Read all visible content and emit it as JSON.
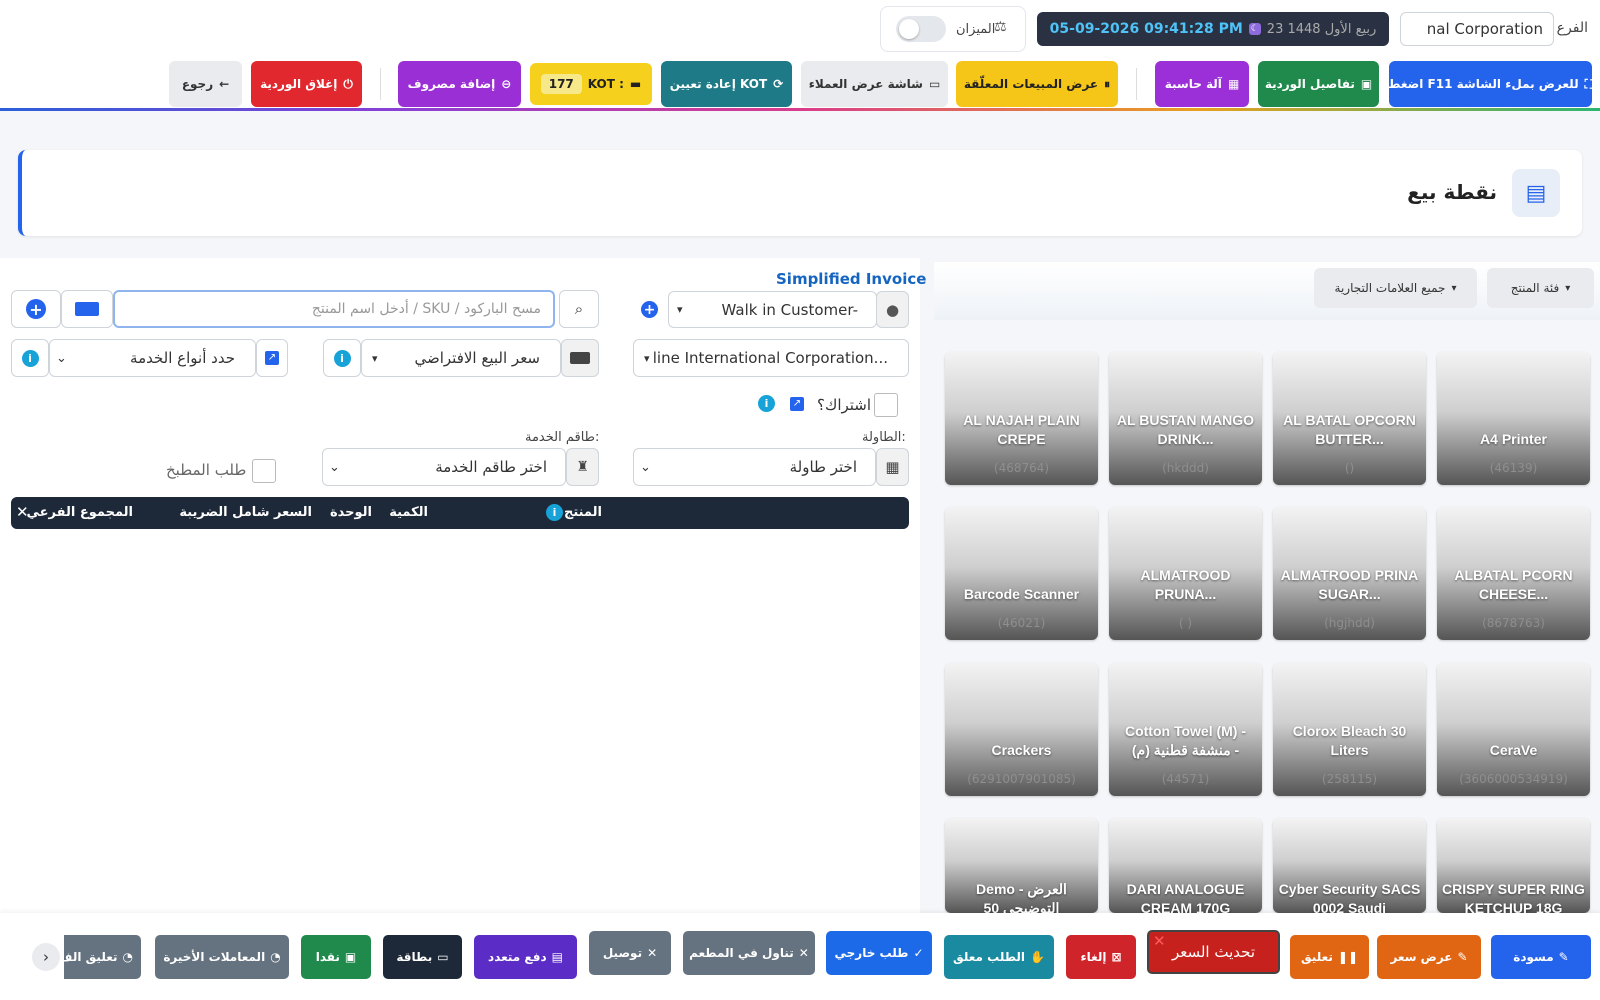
{
  "header": {
    "branch_label": "الفرع",
    "branch_value": "nal Corporation",
    "datetime": "05-09-2026 09:41:28 PM",
    "hijri": "23 ربيع الأول 1448",
    "scale_label": "الميزان",
    "buttons": {
      "fullscreen": "اضغط F11 للعرض بملء الشاشة",
      "shift_details": "تفاصيل الوردية",
      "calculator": "آلة حاسبة",
      "suspended_sales": "عرض المبيعات المعلّقة",
      "customer_display": "شاشة عرض العملاء",
      "reassign_kot": "إعادة تعيين KOT",
      "kot_label": "KOT :",
      "kot_count": "177",
      "add_expense": "إضافة مصروف",
      "close_shift": "إغلاق الوردية",
      "back": "رجوع"
    }
  },
  "page": {
    "title": "نقطة بيع"
  },
  "form": {
    "invoice_type": "Simplified Invoice",
    "customer": "Walk in Customer-",
    "search_placeholder": "أدخل اسم المنتج / SKU / مسح الباركود",
    "company": "line International Corporation...",
    "price_group": "سعر البيع الافتراضي",
    "service_types": "حدد أنواع الخدمة",
    "subscription_label": "اشتراك؟",
    "table_label": "الطاولة:",
    "table_select": "اختر طاولة",
    "staff_label": "طاقم الخدمة:",
    "staff_select": "اختر طاقم الخدمة",
    "kitchen_order": "طلب المطبخ"
  },
  "cart": {
    "columns": [
      "المنتج",
      "الكمية",
      "الوحدة",
      "السعر شامل الضريبة",
      "المجموع الفرعي"
    ]
  },
  "products": {
    "category_filter": "فئة المنتج",
    "brand_filter": "جميع العلامات التجارية",
    "items": [
      {
        "name": "A4 Printer",
        "code": "(46139)"
      },
      {
        "name": "AL BATAL OPCORN BUTTER...",
        "code": "()"
      },
      {
        "name": "AL BUSTAN MANGO DRINK...",
        "code": "(hkddd)"
      },
      {
        "name": "AL NAJAH PLAIN CREPE",
        "code": "(468764)"
      },
      {
        "name": "ALBATAL PCORN CHEESE...",
        "code": "(8678763)"
      },
      {
        "name": "ALMATROOD PRINA SUGAR...",
        "code": "(hgjhdd)"
      },
      {
        "name": "ALMATROOD PRUNA...",
        "code": "( )"
      },
      {
        "name": "Barcode Scanner",
        "code": "(46021)"
      },
      {
        "name": "CeraVe",
        "code": "(3606000534919)"
      },
      {
        "name": "Clorox Bleach 30 Liters",
        "code": "(258115)"
      },
      {
        "name": "Cotton Towel (M) - منشفة قطنية (م) -",
        "code": "(44571)"
      },
      {
        "name": "Crackers",
        "code": "(6291007901085)"
      },
      {
        "name": "CRISPY SUPER RING KETCHUP 18G",
        "code": ""
      },
      {
        "name": "Cyber Security SACS 0002 Saudi",
        "code": ""
      },
      {
        "name": "DARI ANALOGUE CREAM 170G",
        "code": ""
      },
      {
        "name": "Demo - العرض التوضيحي 50",
        "code": ""
      }
    ]
  },
  "footer": {
    "draft": "مسودة",
    "quotation": "عرض سعر",
    "suspend": "تعليق",
    "update_price": "تحديث السعر",
    "cancel": "إلغاء",
    "pending_order": "الطلب معلق",
    "takeaway": "طلب خارجي",
    "dine_in": "تناول في المطعم",
    "delivery": "توصيل",
    "multi_pay": "دفع متعدد",
    "card": "بطاقة",
    "cash": "نقدا",
    "recent": "المعاملات الأخيرة",
    "suspended_list": "تعليق الف"
  }
}
